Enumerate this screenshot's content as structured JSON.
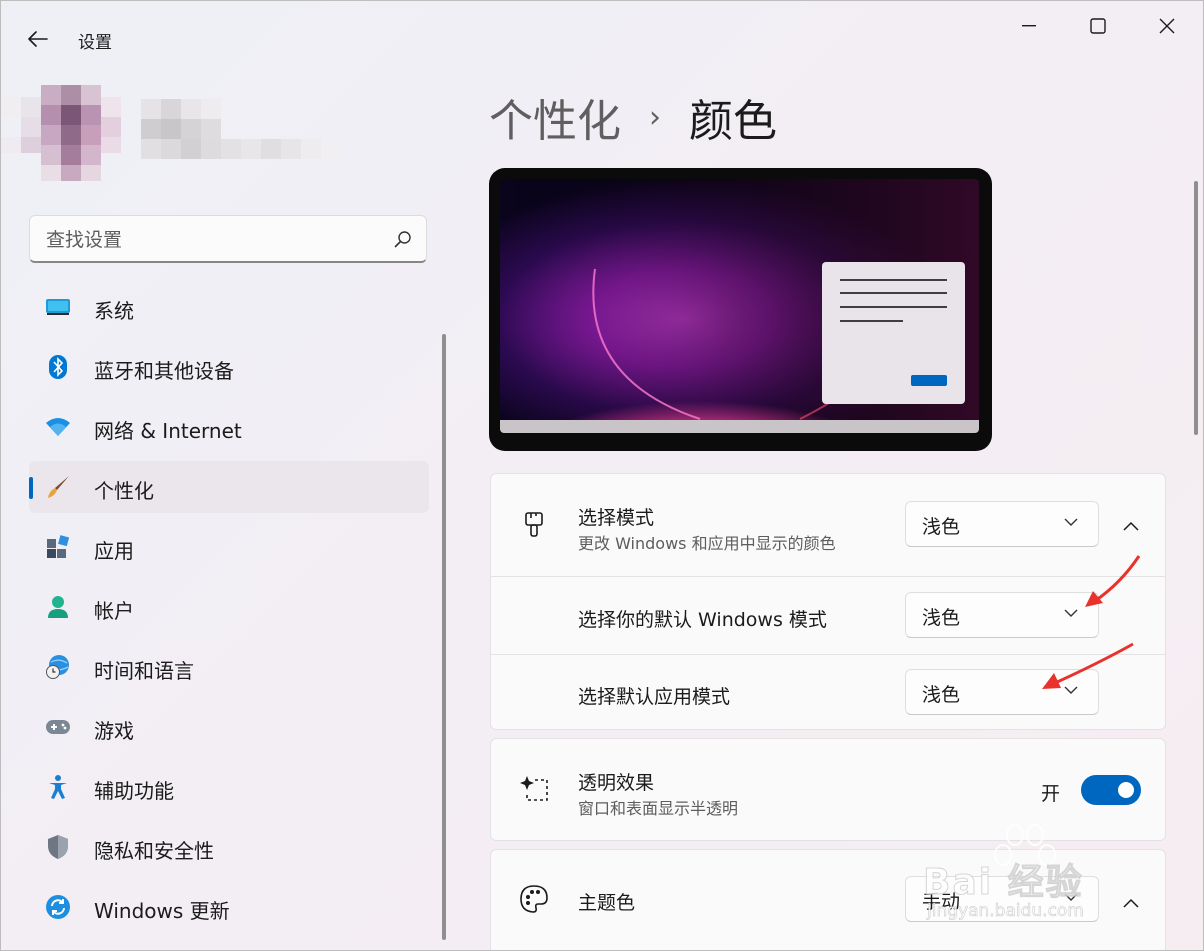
{
  "window": {
    "title": "设置"
  },
  "search": {
    "placeholder": "查找设置"
  },
  "sidebar": {
    "items": [
      {
        "label": "系统",
        "icon": "monitor-icon"
      },
      {
        "label": "蓝牙和其他设备",
        "icon": "bluetooth-icon"
      },
      {
        "label": "网络 & Internet",
        "icon": "wifi-icon"
      },
      {
        "label": "个性化",
        "icon": "paintbrush-icon",
        "active": true
      },
      {
        "label": "应用",
        "icon": "apps-icon"
      },
      {
        "label": "帐户",
        "icon": "person-icon"
      },
      {
        "label": "时间和语言",
        "icon": "globe-clock-icon"
      },
      {
        "label": "游戏",
        "icon": "gamepad-icon"
      },
      {
        "label": "辅助功能",
        "icon": "accessibility-icon"
      },
      {
        "label": "隐私和安全性",
        "icon": "shield-icon"
      },
      {
        "label": "Windows 更新",
        "icon": "windows-update-icon"
      }
    ]
  },
  "breadcrumb": {
    "parent": "个性化",
    "separator": "›",
    "current": "颜色"
  },
  "mode_card": {
    "title": "选择模式",
    "desc": "更改 Windows 和应用中显示的颜色",
    "value": "浅色",
    "windows_mode": {
      "label": "选择你的默认 Windows 模式",
      "value": "浅色"
    },
    "app_mode": {
      "label": "选择默认应用模式",
      "value": "浅色"
    }
  },
  "transparency_card": {
    "title": "透明效果",
    "desc": "窗口和表面显示半透明",
    "state_label": "开",
    "on": true
  },
  "accent_card": {
    "title": "主题色",
    "value": "手动"
  },
  "watermark": {
    "text": "Bai 经验",
    "url_text": "jingyan.baidu.com"
  },
  "colors": {
    "accent": "#0067c0",
    "annotation_arrow": "#e8322b"
  }
}
